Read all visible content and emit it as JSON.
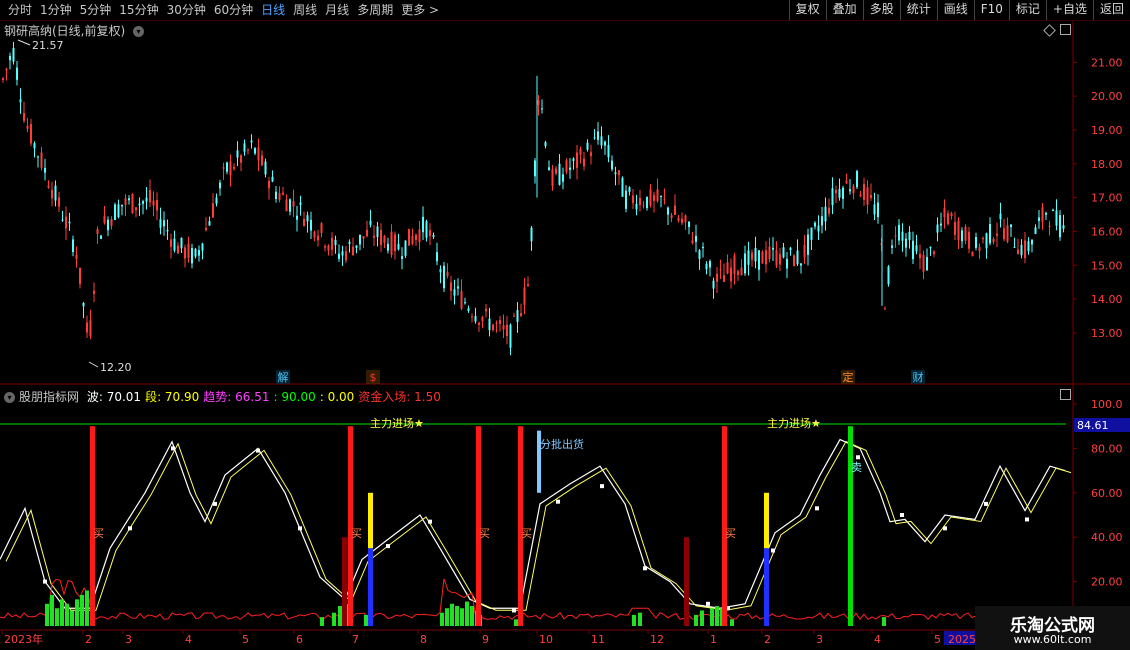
{
  "toolbar": {
    "periods": [
      "分时",
      "1分钟",
      "5分钟",
      "15分钟",
      "30分钟",
      "60分钟",
      "日线",
      "周线",
      "月线",
      "多周期",
      "更多 >"
    ],
    "active_period": "日线",
    "actions": [
      "复权",
      "叠加",
      "多股",
      "统计",
      "画线",
      "F10",
      "标记",
      "+自选",
      "返回"
    ]
  },
  "main_chart": {
    "title": "钢研高纳(日线,前复权)",
    "high_label": "21.57",
    "low_label": "12.20",
    "price_ticks": [
      "21.00",
      "20.00",
      "19.00",
      "18.00",
      "17.00",
      "16.00",
      "15.00",
      "14.00",
      "13.00"
    ],
    "event_markers": [
      {
        "text": "解",
        "color": "#4fc3f7"
      },
      {
        "text": "$",
        "color": "#ff3030"
      },
      {
        "text": "定",
        "color": "#ff8a30"
      },
      {
        "text": "财",
        "color": "#4fc3f7"
      }
    ],
    "colors": {
      "up": "#ff3c3c",
      "down": "#54ffff"
    }
  },
  "indicator": {
    "name": "股朋指标网",
    "params": [
      {
        "label": "波:",
        "value": "70.01",
        "color": "#ffffff"
      },
      {
        "label": "段:",
        "value": "70.90",
        "color": "#ffff00"
      },
      {
        "label": "趋势:",
        "value": "66.51",
        "color": "#ff40ff"
      },
      {
        "label": ":",
        "value": "90.00",
        "color": "#00ff00"
      },
      {
        "label": ":",
        "value": "0.00",
        "color": "#ffff00"
      },
      {
        "label": "资金入场:",
        "value": "1.50",
        "color": "#ff3030"
      }
    ],
    "ticks": [
      "100.0",
      "80.00",
      "60.00",
      "40.00",
      "20.00"
    ],
    "current_value": "84.61",
    "signals": {
      "main_entry": "主力进场★",
      "batch_sell": "分批出货",
      "buy": "买",
      "sell": "卖"
    }
  },
  "time_axis": [
    "2023年",
    "2",
    "3",
    "4",
    "5",
    "6",
    "7",
    "8",
    "9",
    "10",
    "11",
    "12",
    "1",
    "2",
    "3",
    "4",
    "5",
    "2025/0"
  ],
  "watermark": {
    "title": "乐淘公式网",
    "url": "www.60lt.com"
  }
}
